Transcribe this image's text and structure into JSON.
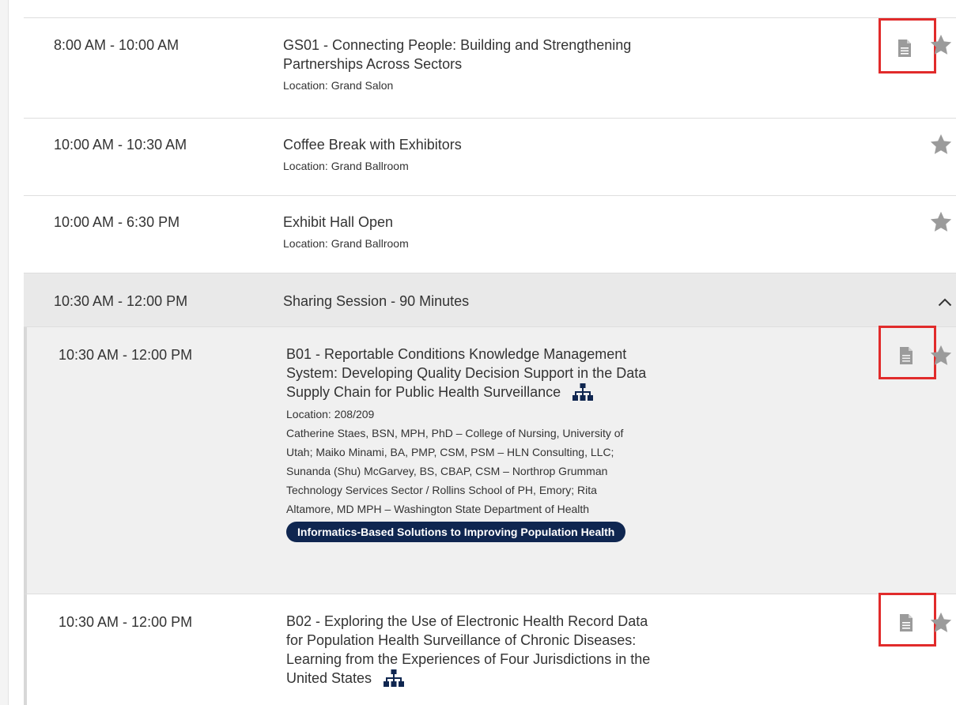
{
  "colors": {
    "tag_bg": "#0f2650",
    "highlight": "#e12b2b",
    "icon_gray": "#9b9b9b",
    "row_gray": "#f0f0f0"
  },
  "icons": {
    "document": "document-icon",
    "favorite": "star-icon",
    "session_map": "org-chart-icon",
    "collapse": "chevron-up-icon"
  },
  "sessions": [
    {
      "time": "8:00 AM - 10:00 AM",
      "title_lines": [
        "GS01 - Connecting People: Building and Strengthening",
        "Partnerships Across Sectors"
      ],
      "location": "Location: Grand Salon"
    },
    {
      "time": "10:00 AM - 10:30 AM",
      "title_lines": [
        "Coffee Break with Exhibitors"
      ],
      "location": "Location: Grand Ballroom"
    },
    {
      "time": "10:00 AM - 6:30 PM",
      "title_lines": [
        "Exhibit Hall Open"
      ],
      "location": "Location: Grand Ballroom"
    }
  ],
  "group": {
    "time": "10:30 AM - 12:00 PM",
    "title": "Sharing Session - 90 Minutes",
    "items": [
      {
        "time": "10:30 AM - 12:00 PM",
        "title_lines": [
          "B01 - Reportable Conditions Knowledge Management",
          "System: Developing Quality Decision Support in the Data",
          "Supply Chain for Public Health Surveillance"
        ],
        "location": "Location: 208/209",
        "author_lines": [
          "Catherine Staes, BSN, MPH, PhD – College of Nursing, University of",
          "Utah; Maiko Minami, BA, PMP, CSM, PSM – HLN Consulting, LLC;",
          "Sunanda (Shu) McGarvey, BS, CBAP, CSM – Northrop Grumman",
          "Technology Services Sector / Rollins School of PH, Emory; Rita",
          "Altamore, MD MPH – Washington State Department of Health"
        ],
        "tag": "Informatics-Based Solutions to Improving Population Health"
      },
      {
        "time": "10:30 AM - 12:00 PM",
        "title_lines": [
          "B02 - Exploring the Use of Electronic Health Record Data",
          "for Population Health Surveillance of Chronic Diseases:",
          "Learning from the Experiences of Four Jurisdictions in the",
          "United States"
        ]
      }
    ]
  }
}
